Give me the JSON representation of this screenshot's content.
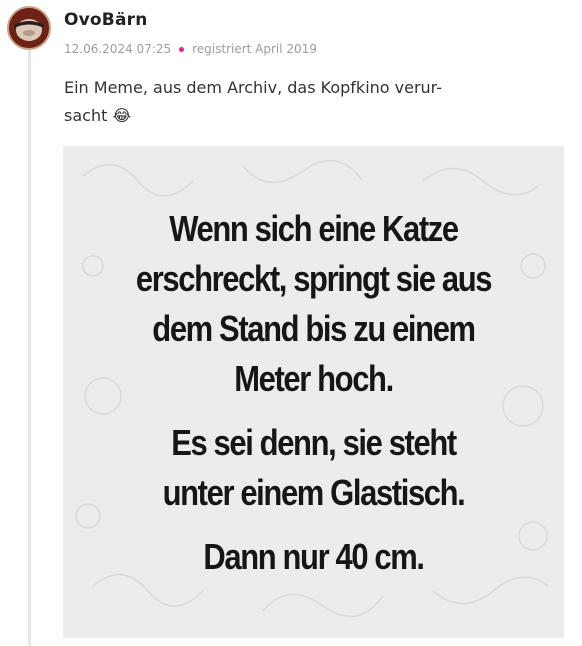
{
  "post": {
    "username": "OvoBärn",
    "timestamp": "12.06.2024 07:25",
    "registered": "registriert April 2019",
    "text_line_1": "Ein Meme, aus dem Archiv, das Kopfkino verur-",
    "text_line_2": "sacht 😂"
  },
  "meme": {
    "paragraph_1": [
      "Wenn sich eine Katze",
      "erschreckt, springt sie aus",
      "dem Stand bis zu einem",
      "Meter hoch."
    ],
    "paragraph_2": [
      "Es sei denn, sie steht",
      "unter einem Glastisch."
    ],
    "paragraph_3": [
      "Dann nur 40 cm."
    ]
  },
  "colors": {
    "accent_dot": "#e0247a",
    "meta_text": "#9d9d9d",
    "meme_background": "#ececec"
  },
  "icons": {
    "avatar": "user-avatar-image",
    "separator": "dot-icon"
  }
}
